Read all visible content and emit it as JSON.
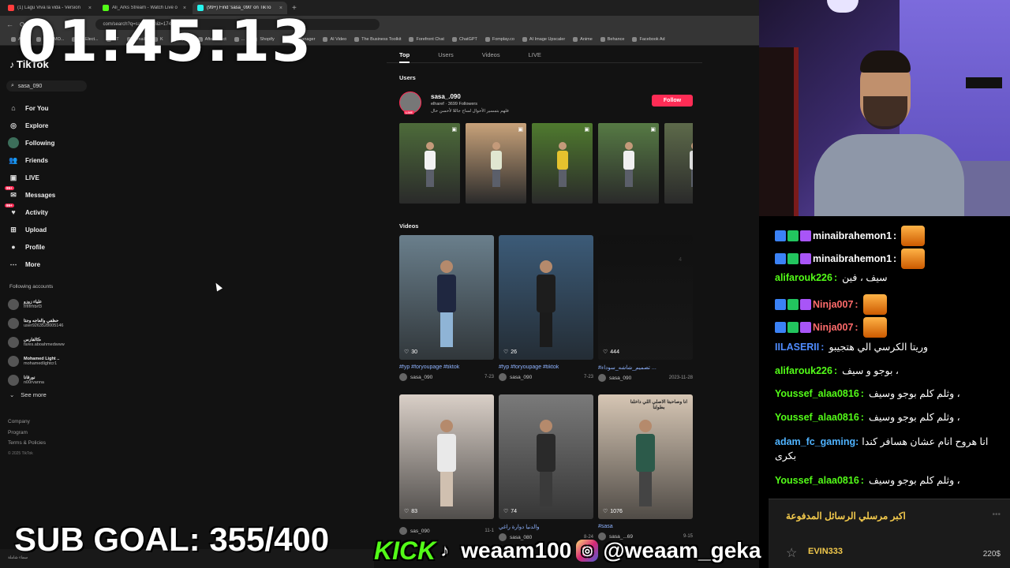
{
  "browser": {
    "tabs": [
      {
        "title": "(1) Lagu Viva la vida - Version",
        "color": "#ff3d3d",
        "active": false
      },
      {
        "title": "Ali_Arks Stream - Watch Live o",
        "color": "#53fc18",
        "active": false
      },
      {
        "title": "(99+) Find 'sasa_090' on TikTo",
        "color": "#25f4ee",
        "active": true
      }
    ],
    "new_tab": "+",
    "address": "com/search?q=sasa_090&t=1745",
    "bookmarks": [
      "Apps",
      "EHC-MO...",
      "EEElect...",
      "YT",
      "Gmail",
      "K",
      "replay",
      "After Effect",
      "...",
      "Shopify",
      "Ads Manager",
      "AI Video",
      "The Business Toolkit",
      "Forefront Chat",
      "ChatGPT",
      "Fomplay.co",
      "AI Image Upscaler",
      "Anime",
      "Behance",
      "Facebook Ad"
    ]
  },
  "tiktok": {
    "logo": "TikTok",
    "search_value": "sasa_090",
    "nav": [
      {
        "label": "For You",
        "icon": "home-icon",
        "glyph": "⌂"
      },
      {
        "label": "Explore",
        "icon": "compass-icon",
        "glyph": "◎"
      },
      {
        "label": "Following",
        "icon": "following-avatar-icon",
        "glyph": ""
      },
      {
        "label": "Friends",
        "icon": "friends-icon",
        "glyph": "👥"
      },
      {
        "label": "LIVE",
        "icon": "live-icon",
        "glyph": "▣"
      },
      {
        "label": "Messages",
        "icon": "messages-icon",
        "glyph": "✉",
        "badge": "99+"
      },
      {
        "label": "Activity",
        "icon": "activity-icon",
        "glyph": "♥",
        "badge": "99+"
      },
      {
        "label": "Upload",
        "icon": "upload-icon",
        "glyph": "⊞"
      },
      {
        "label": "Profile",
        "icon": "profile-icon",
        "glyph": "●"
      },
      {
        "label": "More",
        "icon": "more-icon",
        "glyph": "⋯"
      }
    ],
    "following_title": "Following accounts",
    "following": [
      {
        "name": "علياء زوزو",
        "handle": "frfrfrfrbrf3"
      },
      {
        "name": "حظفي والعاجه وجتا",
        "handle": "user9263528005146"
      },
      {
        "name": "ڪالفارس",
        "handle": "fares.aboahmedwww"
      },
      {
        "name": "Mohamed Light ..",
        "handle": "mohamedlightcr1"
      },
      {
        "name": "نورقانا",
        "handle": "n00rvanna"
      }
    ],
    "see_more": "See more",
    "footer": [
      "Company",
      "Program",
      "Terms & Policies"
    ],
    "copyright": "© 2025 TikTok",
    "tabs": [
      "Top",
      "Users",
      "Videos",
      "LIVE"
    ],
    "users_title": "Users",
    "user": {
      "name": "sasa_.090",
      "meta": "elharef · 3699 Followers",
      "bio": "فلهم بتمسير الأحوال لساح جاللا لأحسن حال",
      "live": "LIVE",
      "follow": "Follow"
    },
    "videos_title": "Videos",
    "videos": [
      {
        "likes": "30",
        "caption": "#fyp #foryoupage #tiktok",
        "author": "sasa_090",
        "date": "7-23",
        "bg": "#6a7f8c",
        "shirt": "#1f2740",
        "legs": "#8fb4d6"
      },
      {
        "likes": "26",
        "caption": "#fyp #foryoupage #tiktok",
        "author": "sasa_090",
        "date": "7-23",
        "bg": "#3c5b78",
        "shirt": "#1d1d1d",
        "legs": "#1b1b1b"
      },
      {
        "likes": "444",
        "caption": "#تصميم_شاشه_سوداء ...",
        "author": "sasa_090",
        "date": "2023-11-28",
        "bg": "#111",
        "shirt": "#111",
        "legs": "#111",
        "marker": "4"
      },
      {
        "likes": "83",
        "caption": "",
        "author": "sas_090",
        "date": "11-1",
        "bg": "#d9cfc7",
        "shirt": "#e9e9e9",
        "legs": "#d0c0b0"
      },
      {
        "likes": "74",
        "caption": "والدنيا دوارة راغي",
        "author": "sasa_080",
        "date": "8-24",
        "bg": "#7a7a7a",
        "shirt": "#2a2a2a",
        "legs": "#3a3a3a"
      },
      {
        "likes": "1076",
        "caption": "#sasa",
        "author": "sasa_...69",
        "date": "9-15",
        "bg": "#d6c6b4",
        "shirt": "#2c5a4a",
        "legs": "#444",
        "overlay": "انا وصاحبتا الاصلي اللي داخلنا بطولنا"
      }
    ],
    "user_thumbs": [
      {
        "bg": "#4d6b3a",
        "shirt": "#f2f2f2"
      },
      {
        "bg": "#c8a27a",
        "shirt": "#e0e6d0"
      },
      {
        "bg": "#4f7a2e",
        "shirt": "#e4c22e"
      },
      {
        "bg": "#567a44",
        "shirt": "#f0f0f0"
      },
      {
        "bg": "#5d6a4a",
        "shirt": "#dcdcdc"
      }
    ]
  },
  "chat": {
    "messages": [
      {
        "user": "minaibrahemon1",
        "color": "#ffffff",
        "text": "",
        "emote": true,
        "badges": true
      },
      {
        "user": "minaibrahemon1",
        "color": "#ffffff",
        "text": "",
        "emote": true,
        "badges": true
      },
      {
        "user": "alifarouk226",
        "color": "#53fc18",
        "text": "سيف ، فين"
      },
      {
        "user": "Ninja007",
        "color": "#ff6b6b",
        "text": "",
        "emote": true,
        "badges": true
      },
      {
        "user": "Ninja007",
        "color": "#ff6b6b",
        "text": "",
        "emote": true,
        "badges": true
      },
      {
        "user": "IILASERII",
        "color": "#4f8cff",
        "text": "وريتا الكرسي الي هتجيبو"
      },
      {
        "user": "alifarouk226",
        "color": "#53fc18",
        "text": "بوجو و سيف ،"
      },
      {
        "user": "Youssef_alaa0816",
        "color": "#53fc18",
        "text": "وثلم كلم بوجو وسيف ،"
      },
      {
        "user": "Youssef_alaa0816",
        "color": "#53fc18",
        "text": "وثلم كلم بوجو وسيف ،"
      },
      {
        "user": "adam_fc_gaming",
        "color": "#4fb3ff",
        "text": "انا هروح انام عشان هسافر كندا بكرى"
      },
      {
        "user": "Youssef_alaa0816",
        "color": "#53fc18",
        "text": "وثلم كلم بوجو وسيف ،"
      }
    ],
    "paid_title": "اكبر مرسلي الرسائل المدفوعة",
    "paid_more": "•••",
    "top_sender": "EVIN333",
    "top_amount": "220$"
  },
  "overlay": {
    "timer": "01:45:13",
    "sub_goal": "SUB GOAL: 355/400",
    "kick": "KICK",
    "kick_handle": "weaam100",
    "ig_handle": "@weaam_geka",
    "taskbar_text": "سماء شاملة"
  }
}
